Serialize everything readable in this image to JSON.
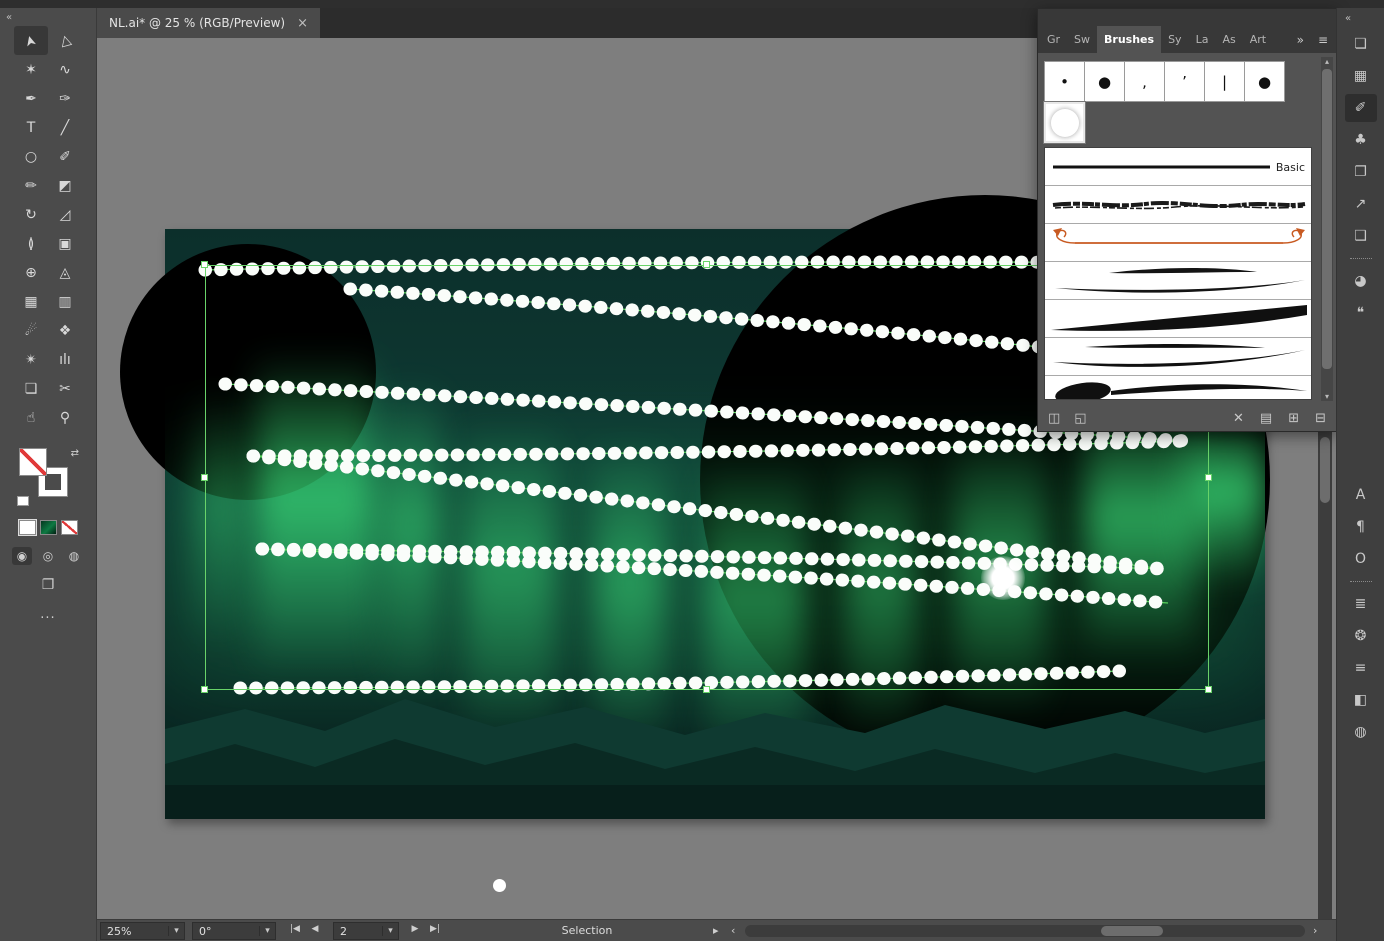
{
  "ui": {
    "chevron_down": "▾",
    "collapse": "«",
    "overflow": "»",
    "panel_menu": "≡",
    "ellipsis": "···"
  },
  "tabbar": {
    "title": "NL.ai* @ 25 % (RGB/Preview)",
    "close": "×"
  },
  "toolbar": {
    "swap_icon": "⇄",
    "screen_mode_glyph": "❐",
    "tools": [
      {
        "name": "selection-tool",
        "glyph": "➤",
        "active": true
      },
      {
        "name": "direct-selection-tool",
        "glyph": "▷"
      },
      {
        "name": "magic-wand-tool",
        "glyph": "✶"
      },
      {
        "name": "lasso-tool",
        "glyph": "∿"
      },
      {
        "name": "pen-tool",
        "glyph": "✒"
      },
      {
        "name": "curvature-tool",
        "glyph": "✑"
      },
      {
        "name": "type-tool",
        "glyph": "T"
      },
      {
        "name": "line-segment-tool",
        "glyph": "╱"
      },
      {
        "name": "ellipse-tool",
        "glyph": "○"
      },
      {
        "name": "paintbrush-tool",
        "glyph": "✐"
      },
      {
        "name": "pencil-tool",
        "glyph": "✏"
      },
      {
        "name": "eraser-tool",
        "glyph": "◩"
      },
      {
        "name": "rotate-tool",
        "glyph": "↻"
      },
      {
        "name": "scale-tool",
        "glyph": "◿"
      },
      {
        "name": "width-tool",
        "glyph": "≬"
      },
      {
        "name": "free-transform-tool",
        "glyph": "▣"
      },
      {
        "name": "shape-builder-tool",
        "glyph": "⊕"
      },
      {
        "name": "perspective-grid-tool",
        "glyph": "◬"
      },
      {
        "name": "mesh-tool",
        "glyph": "▦"
      },
      {
        "name": "gradient-tool",
        "glyph": "▥"
      },
      {
        "name": "eyedropper-tool",
        "glyph": "☄"
      },
      {
        "name": "blend-tool",
        "glyph": "❖"
      },
      {
        "name": "symbol-sprayer-tool",
        "glyph": "✴"
      },
      {
        "name": "column-graph-tool",
        "glyph": "ılı"
      },
      {
        "name": "artboard-tool",
        "glyph": "❏"
      },
      {
        "name": "slice-tool",
        "glyph": "✂"
      },
      {
        "name": "hand-tool",
        "glyph": "☝"
      },
      {
        "name": "zoom-tool",
        "glyph": "⚲"
      }
    ],
    "draw_modes": [
      {
        "name": "draw-normal-button",
        "glyph": "◉",
        "active": true
      },
      {
        "name": "draw-behind-button",
        "glyph": "◎"
      },
      {
        "name": "draw-inside-button",
        "glyph": "◍"
      }
    ]
  },
  "brushes_panel": {
    "tabs": [
      {
        "name": "tab-gradient",
        "label": "Gr"
      },
      {
        "name": "tab-swatches",
        "label": "Sw"
      },
      {
        "name": "tab-brushes",
        "label": "Brushes",
        "active": true
      },
      {
        "name": "tab-symbols",
        "label": "Sy"
      },
      {
        "name": "tab-layers",
        "label": "La"
      },
      {
        "name": "tab-assets",
        "label": "As"
      },
      {
        "name": "tab-artboards",
        "label": "Art"
      }
    ],
    "swatches": [
      {
        "name": "brush-calligraphic-small",
        "glyph": "•"
      },
      {
        "name": "brush-calligraphic-large",
        "glyph": "●"
      },
      {
        "name": "brush-taper-small",
        "glyph": ","
      },
      {
        "name": "brush-taper",
        "glyph": "’"
      },
      {
        "name": "brush-flat",
        "glyph": "|"
      },
      {
        "name": "brush-round",
        "glyph": "●"
      }
    ],
    "list": [
      {
        "name": "brush-item-basic",
        "label": "Basic"
      },
      {
        "name": "brush-item-charcoal",
        "label": ""
      },
      {
        "name": "brush-item-arrow-ornament",
        "label": ""
      },
      {
        "name": "brush-item-thin-taper",
        "label": ""
      },
      {
        "name": "brush-item-wedge",
        "label": ""
      },
      {
        "name": "brush-item-wide-taper",
        "label": ""
      },
      {
        "name": "brush-item-ink-blob",
        "label": ""
      }
    ],
    "footer_left": [
      {
        "name": "brush-libraries-icon",
        "glyph": "◫"
      },
      {
        "name": "libraries-panel-icon",
        "glyph": "◱"
      }
    ],
    "footer_right": [
      {
        "name": "remove-brush-stroke-icon",
        "glyph": "✕"
      },
      {
        "name": "brush-options-icon",
        "glyph": "▤"
      },
      {
        "name": "new-brush-icon",
        "glyph": "⊞"
      },
      {
        "name": "delete-brush-icon",
        "glyph": "⊟"
      }
    ]
  },
  "dock": {
    "icons": [
      {
        "name": "artboards-panel-icon",
        "glyph": "❏"
      },
      {
        "name": "asset-export-panel-icon",
        "glyph": "▦"
      },
      {
        "name": "brushes-panel-icon",
        "glyph": "✐",
        "active": true
      },
      {
        "name": "symbols-panel-icon",
        "glyph": "♣"
      },
      {
        "name": "layers-panel-icon",
        "glyph": "❐"
      },
      {
        "name": "export-panel-icon",
        "glyph": "↗"
      },
      {
        "name": "libraries-panel-icon",
        "glyph": "❑"
      },
      {
        "sep": true
      },
      {
        "name": "color-panel-icon",
        "glyph": "◕"
      },
      {
        "name": "comments-panel-icon",
        "glyph": "❝"
      },
      {
        "spacer": true
      },
      {
        "name": "character-panel-icon",
        "glyph": "A"
      },
      {
        "name": "paragraph-panel-icon",
        "glyph": "¶"
      },
      {
        "name": "opentype-panel-icon",
        "glyph": "O"
      },
      {
        "sep": true
      },
      {
        "name": "properties-sliders-icon",
        "glyph": "≣"
      },
      {
        "name": "appearance-orb-icon",
        "glyph": "❂"
      },
      {
        "name": "stroke-panel-icon",
        "glyph": "≡"
      },
      {
        "name": "gradient-panel-icon",
        "glyph": "◧"
      },
      {
        "name": "navigator-sphere-icon",
        "glyph": "◍"
      }
    ]
  },
  "statusbar": {
    "zoom": "25%",
    "rotation": "0°",
    "artboard": "2",
    "status": "Selection",
    "proxy": "▸",
    "scroll_left": "‹",
    "scroll_right": "›",
    "nav_prev_group": [
      {
        "name": "first-artboard-button",
        "glyph": "|◀"
      },
      {
        "name": "prev-artboard-button",
        "glyph": "◀"
      }
    ],
    "nav_next_group": [
      {
        "name": "next-artboard-button",
        "glyph": "▶"
      },
      {
        "name": "last-artboard-button",
        "glyph": "▶|"
      }
    ]
  },
  "colors": {
    "pasteboard": "#7e7e7e",
    "panel_bg": "#535353",
    "aurora_green": "#37f07c",
    "selection_green": "#6fdc6f",
    "ornament_orange": "#c85a21"
  }
}
